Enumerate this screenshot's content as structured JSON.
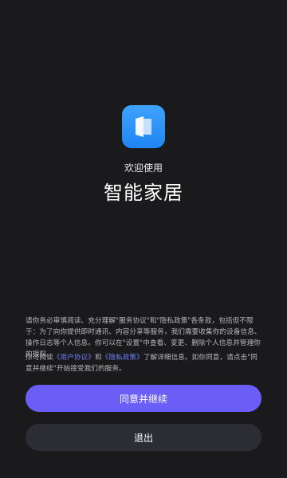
{
  "app": {
    "welcome": "欢迎使用",
    "name": "智能家居"
  },
  "logo": {
    "icon": "app-logo-icon",
    "color": "#2b95f8"
  },
  "privacy": {
    "para1": "请你务必审慎阅读、充分理解\"服务协议\"和\"隐私政策\"各条款，包括但不限于：为了向你提供即时通讯、内容分享等服务，我们需要收集你的设备信息、操作日志等个人信息。你可以在\"设置\"中查看、变更、删除个人信息并管理你的授权。",
    "para2_prefix": "你可阅读",
    "user_agreement_link": "《用户协议》",
    "para2_and": "和",
    "privacy_policy_link": "《隐私政策》",
    "para2_suffix": "了解详细信息。如你同意，请点击\"同意并继续\"开始接受我们的服务。"
  },
  "buttons": {
    "agree": "同意并继续",
    "exit": "退出"
  },
  "colors": {
    "background": "#1a1a1c",
    "primary": "#6b5ef7",
    "secondary_button": "#2c2d34",
    "link": "#6f7cf6"
  }
}
